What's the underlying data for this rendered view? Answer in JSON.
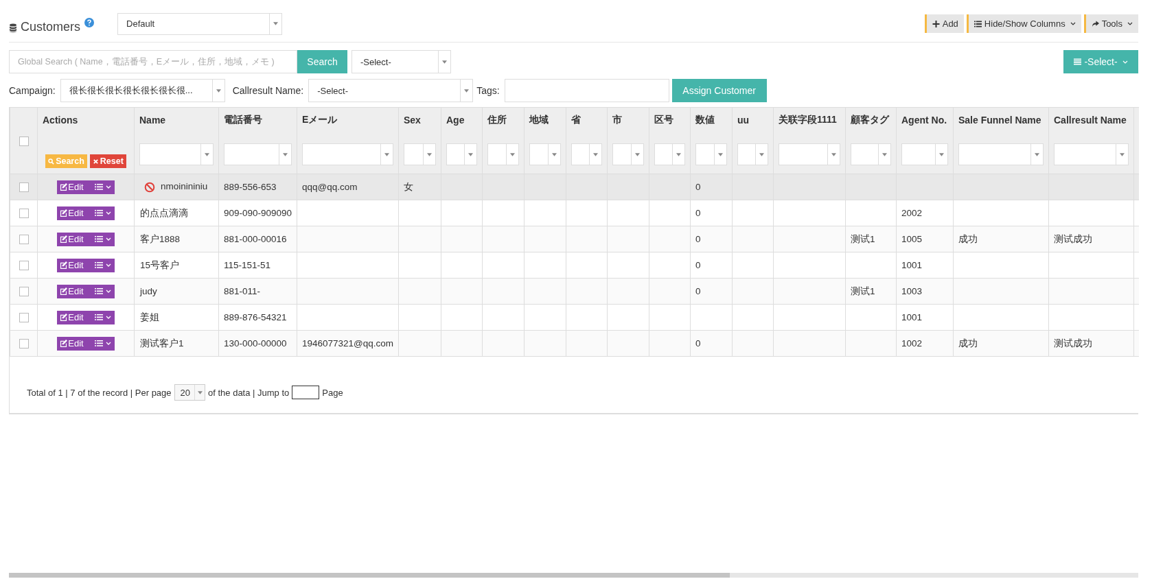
{
  "header": {
    "title": "Customers",
    "view_select": "Default",
    "buttons": [
      {
        "label": "Add",
        "kind": "add",
        "caret": false
      },
      {
        "label": "Hide/Show Columns",
        "kind": "columns",
        "caret": true
      },
      {
        "label": "Tools",
        "kind": "tools",
        "caret": true
      }
    ]
  },
  "search": {
    "placeholder": "Global Search ( Name，電話番号，Eメール，住所，地域，メモ )",
    "button": "Search",
    "select": "-Select-",
    "bulk_select": "-Select-"
  },
  "filters": {
    "campaign_label": "Campaign:",
    "campaign": "很长很长很长很长很长很长很...",
    "callresult_label": "Callresult Name:",
    "callresult": "-Select-",
    "tags_label": "Tags:",
    "assign_button": "Assign Customer"
  },
  "table": {
    "select_all_checked": false,
    "actions_header": "Actions",
    "search_button": "Search",
    "reset_button": "Reset",
    "columns": [
      "Name",
      "電話番号",
      "Eメール",
      "Sex",
      "Age",
      "住所",
      "地域",
      "省",
      "市",
      "区号",
      "数値",
      "uu",
      "关联字段1111",
      "顧客タグ",
      "Agent No.",
      "Sale Funnel Name",
      "Callresult Name"
    ],
    "rows": [
      {
        "checked": false,
        "highlighted": true,
        "blocked": true,
        "edit": "Edit",
        "cells": [
          "nmoinininiu",
          "889-556-653",
          "qqq@qq.com",
          "女",
          null,
          null,
          null,
          null,
          null,
          null,
          "0",
          null,
          null,
          null,
          null,
          null,
          null
        ]
      },
      {
        "checked": false,
        "highlighted": false,
        "blocked": false,
        "edit": "Edit",
        "cells": [
          "的点点滴滴",
          "909-090-909090",
          null,
          null,
          null,
          null,
          null,
          null,
          null,
          null,
          "0",
          null,
          null,
          null,
          "2002",
          null,
          null
        ]
      },
      {
        "checked": false,
        "highlighted": false,
        "blocked": false,
        "edit": "Edit",
        "cells": [
          "客户1888",
          "881-000-00016",
          null,
          null,
          null,
          null,
          null,
          null,
          null,
          null,
          "0",
          null,
          null,
          "测试1",
          "1005",
          "成功",
          "测试成功"
        ]
      },
      {
        "checked": false,
        "highlighted": false,
        "blocked": false,
        "edit": "Edit",
        "cells": [
          "15号客户",
          "115-151-51",
          null,
          null,
          null,
          null,
          null,
          null,
          null,
          null,
          "0",
          null,
          null,
          null,
          "1001",
          null,
          null
        ]
      },
      {
        "checked": false,
        "highlighted": false,
        "blocked": false,
        "edit": "Edit",
        "cells": [
          "judy",
          "881-011-",
          null,
          null,
          null,
          null,
          null,
          null,
          null,
          null,
          "0",
          null,
          null,
          "测试1",
          "1003",
          null,
          null
        ]
      },
      {
        "checked": false,
        "highlighted": false,
        "blocked": false,
        "edit": "Edit",
        "cells": [
          "姜姐",
          "889-876-54321",
          null,
          null,
          null,
          null,
          null,
          null,
          null,
          null,
          null,
          null,
          null,
          null,
          "1001",
          null,
          null
        ]
      },
      {
        "checked": false,
        "highlighted": false,
        "blocked": false,
        "edit": "Edit",
        "cells": [
          "测试客户1",
          "130-000-00000",
          "1946077321@qq.com",
          null,
          null,
          null,
          null,
          null,
          null,
          null,
          "0",
          null,
          null,
          null,
          "1002",
          "成功",
          "测试成功"
        ]
      }
    ]
  },
  "footer": {
    "summary": "Total of 1 | 7 of the record | Per page",
    "per_page": "20",
    "middle": "of the data | Jump to",
    "page": "Page"
  }
}
